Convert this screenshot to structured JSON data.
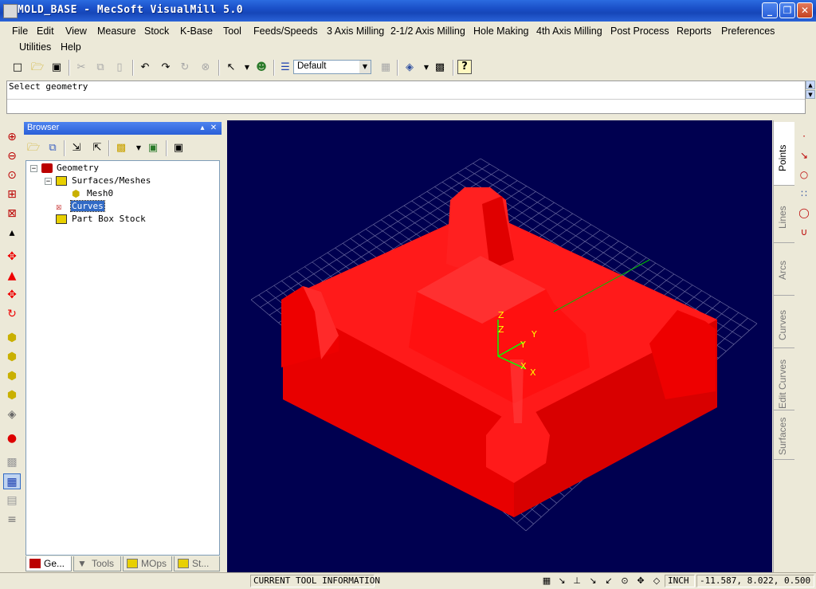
{
  "window": {
    "title": "MOLD_BASE - MecSoft  VisualMill 5.0",
    "minimize": "_",
    "maximize": "❐",
    "close": "✕"
  },
  "menu": [
    "File",
    "Edit",
    "View",
    "Measure",
    "Stock",
    "K-Base",
    "Tool",
    "Feeds/Speeds",
    "3 Axis Milling",
    "2-1/2 Axis Milling",
    "Hole Making",
    "4th Axis Milling",
    "Post Process",
    "Reports",
    "Preferences",
    "Utilities",
    "Help"
  ],
  "toolbar": {
    "view_combo": "Default"
  },
  "prompt": {
    "text": "Select geometry"
  },
  "browser": {
    "title": "Browser",
    "tree": {
      "geometry": "Geometry",
      "surfaces": "Surfaces/Meshes",
      "mesh": "Mesh0",
      "curves": "Curves",
      "stock": "Part Box Stock"
    },
    "tabs": [
      "Ge...",
      "Tools",
      "MOps",
      "St..."
    ]
  },
  "viewport": {
    "axis_z": "Z",
    "axis_y": "Y",
    "axis_x": "X",
    "model_color": "#ff0000",
    "background": "#000050"
  },
  "right_tabs": [
    "Points",
    "Lines",
    "Arcs",
    "Curves",
    "Edit Curves",
    "Surfaces"
  ],
  "status": {
    "tool_info": "CURRENT TOOL INFORMATION",
    "units": "INCH",
    "coords": "-11.587, 8.022, 0.500"
  }
}
